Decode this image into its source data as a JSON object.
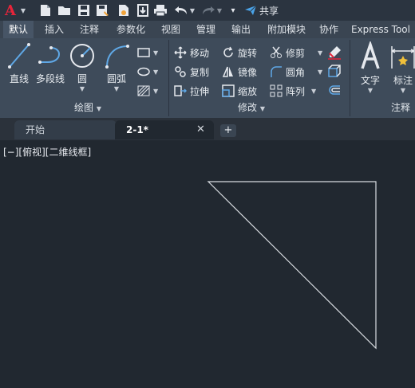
{
  "app": {
    "logo": "A"
  },
  "quick_access": {
    "icons": [
      "new-icon",
      "open-icon",
      "save-icon",
      "save-as-icon",
      "open-from-web-icon",
      "save-to-web-icon",
      "print-icon",
      "undo-icon",
      "redo-icon",
      "customize-icon"
    ],
    "share_label": "共享"
  },
  "ribbon_tabs": [
    {
      "label": "默认",
      "active": true
    },
    {
      "label": "插入"
    },
    {
      "label": "注释"
    },
    {
      "label": "参数化"
    },
    {
      "label": "视图"
    },
    {
      "label": "管理"
    },
    {
      "label": "输出"
    },
    {
      "label": "附加模块"
    },
    {
      "label": "协作"
    },
    {
      "label": "Express Tool"
    }
  ],
  "panels": {
    "draw": {
      "title": "绘图",
      "line": "直线",
      "polyline": "多段线",
      "circle": "圆",
      "arc": "圆弧"
    },
    "modify": {
      "title": "修改",
      "move": "移动",
      "rotate": "旋转",
      "trim": "修剪",
      "copy": "复制",
      "mirror": "镜像",
      "fillet": "圆角",
      "stretch": "拉伸",
      "scale": "缩放",
      "array": "阵列"
    },
    "annotation": {
      "title": "注释",
      "text": "文字",
      "dimension": "标注"
    }
  },
  "doc_tabs": [
    {
      "label": "开始",
      "active": false
    },
    {
      "label": "2-1*",
      "active": true
    }
  ],
  "viewport": {
    "label": "[−][俯视][二维线框]"
  },
  "drawing": {
    "shape": "right-triangle",
    "line_color": "#d8dce0"
  }
}
